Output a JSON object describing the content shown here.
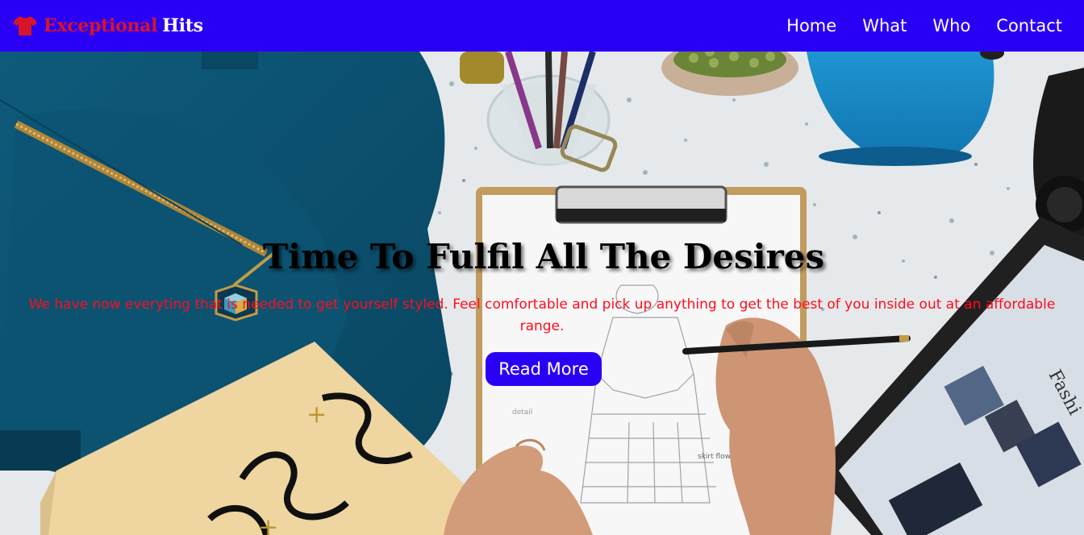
{
  "header": {
    "brand_part1": "Exceptional",
    "brand_part2": "Hits",
    "brand_icon": "tshirt-icon",
    "nav": [
      {
        "label": "Home"
      },
      {
        "label": "What"
      },
      {
        "label": "Who"
      },
      {
        "label": "Contact"
      }
    ]
  },
  "hero": {
    "title": "Time To Fulfil All The Desires",
    "subtitle": "We have now everyting that is needed to get yourself styled. Feel comfortable and pick up anything to get the best of you inside out at an affordable range.",
    "button_label": "Read More"
  },
  "colors": {
    "nav_background": "#2a00f5",
    "brand_accent": "#d6152a",
    "subtitle_text": "#ff0d1d",
    "button_background": "#2a00f5"
  }
}
